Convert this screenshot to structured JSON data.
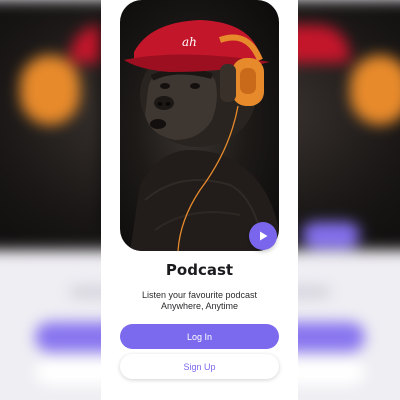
{
  "colors": {
    "accent": "#7c6aee",
    "play": "#7a66ec",
    "cap": "#c4162b",
    "headphones": "#e78a2b",
    "title": "#1b1b1f"
  },
  "hero": {
    "image": "gorilla-with-red-cap-and-orange-headphones",
    "play_icon": "play-icon"
  },
  "title": "Podcast",
  "subtitle": {
    "line1": "Listen your favourite podcast",
    "line2": "Anywhere, Anytime"
  },
  "buttons": {
    "login": "Log In",
    "signup": "Sign Up"
  }
}
